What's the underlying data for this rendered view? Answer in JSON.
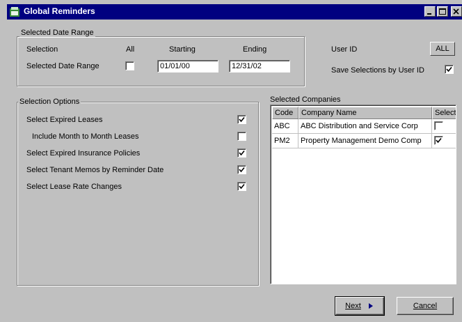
{
  "window": {
    "title": "Global Reminders"
  },
  "date_range": {
    "group_label": "Selected Date Range",
    "selection_label": "Selection",
    "all_label": "All",
    "starting_label": "Starting",
    "ending_label": "Ending",
    "row_label": "Selected Date Range",
    "all_checked": false,
    "starting_value": "01/01/00",
    "ending_value": "12/31/02"
  },
  "user": {
    "user_id_label": "User ID",
    "user_id_value": "ALL",
    "save_label": "Save Selections by User ID",
    "save_checked": true
  },
  "options": {
    "group_label": "Selection Options",
    "items": [
      {
        "label": "Select Expired Leases",
        "checked": true
      },
      {
        "label": "Include Month to Month Leases",
        "checked": false
      },
      {
        "label": "Select Expired Insurance Policies",
        "checked": true
      },
      {
        "label": "Select Tenant Memos by Reminder Date",
        "checked": true
      },
      {
        "label": "Select Lease Rate Changes",
        "checked": true
      }
    ]
  },
  "companies": {
    "group_label": "Selected Companies",
    "columns": [
      "Code",
      "Company Name",
      "Select"
    ],
    "rows": [
      {
        "code": "ABC",
        "name": "ABC Distribution and Service Corp",
        "selected": false
      },
      {
        "code": "PM2",
        "name": "Property Management Demo Comp",
        "selected": true
      }
    ]
  },
  "buttons": {
    "next": "Next",
    "cancel": "Cancel"
  }
}
